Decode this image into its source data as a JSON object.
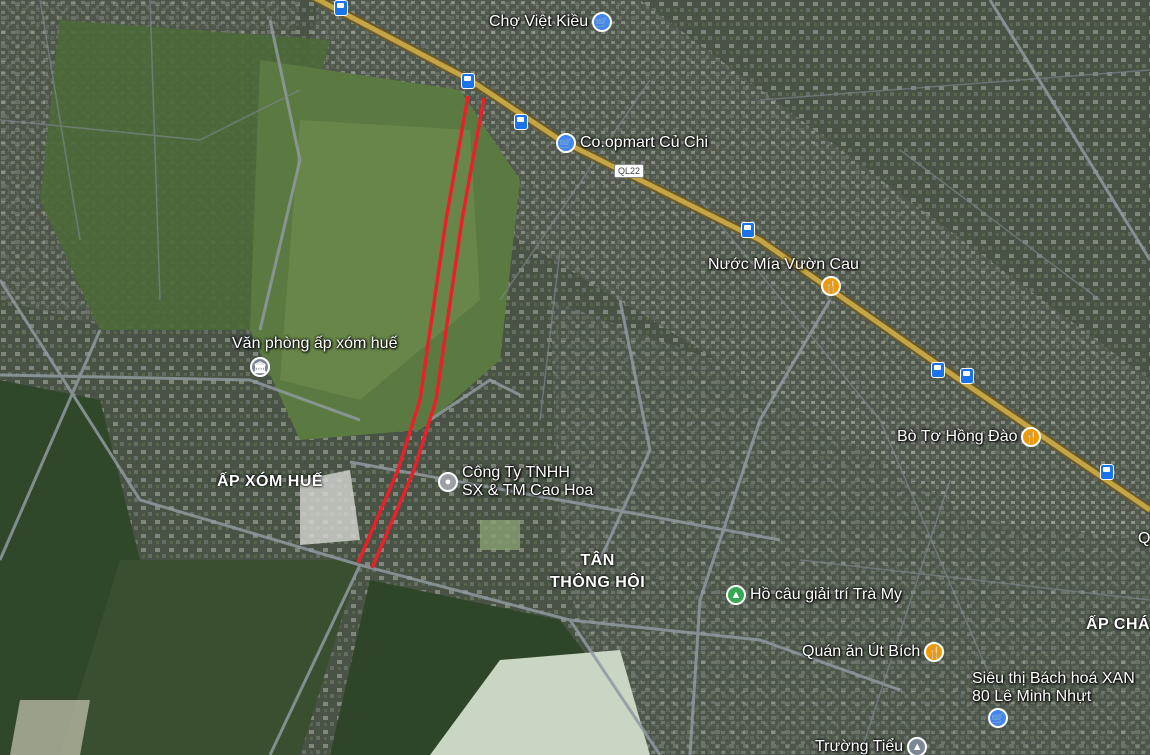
{
  "map": {
    "type": "satellite",
    "route_color": "#e8202a",
    "road_colors": {
      "highway": "#b9973d",
      "road": "#8f9aa0"
    }
  },
  "areas": [
    {
      "id": "ap-xom-hue",
      "label": "ẤP XÓM HUẾ"
    },
    {
      "id": "tan-thong-hoi",
      "label": "TÂN\nTHÔNG HỘI"
    },
    {
      "id": "ap-cha",
      "label": "ẤP CHÁ"
    }
  ],
  "pois": [
    {
      "id": "cho-viet-kieu",
      "label": "Chợ Việt Kiều",
      "icon": "shopping-cart-icon",
      "category": "shop"
    },
    {
      "id": "coopmart",
      "label": "Co.opmart Củ Chi",
      "icon": "shopping-cart-icon",
      "category": "shop"
    },
    {
      "id": "nuoc-mia",
      "label": "Nước Mía Vườn Cau",
      "icon": "fork-knife-icon",
      "category": "food"
    },
    {
      "id": "van-phong",
      "label": "Văn phòng ấp xóm huế",
      "icon": "government-building-icon",
      "category": "gov"
    },
    {
      "id": "bo-to",
      "label": "Bò Tơ Hồng Đào",
      "icon": "fork-knife-icon",
      "category": "food"
    },
    {
      "id": "cong-ty",
      "label": "Công Ty TNHH\nSX & TM Cao Hoa",
      "icon": "location-pin-icon",
      "category": "grey"
    },
    {
      "id": "ho-cau",
      "label": "Hồ câu giải trí Trà My",
      "icon": "tree-icon",
      "category": "park"
    },
    {
      "id": "quan-an",
      "label": "Quán ăn Út Bích",
      "icon": "fork-knife-icon",
      "category": "food"
    },
    {
      "id": "sieu-thi",
      "label": "Siêu thị Bách hoá XAN\n80 Lê Minh Nhựt",
      "icon": "shopping-cart-icon",
      "category": "shop"
    },
    {
      "id": "truong",
      "label": "Trường Tiểu",
      "icon": "school-icon",
      "category": "gov"
    }
  ],
  "road_shields": [
    {
      "label": "QL22"
    }
  ],
  "edge_labels": [
    {
      "label": "Q"
    }
  ]
}
